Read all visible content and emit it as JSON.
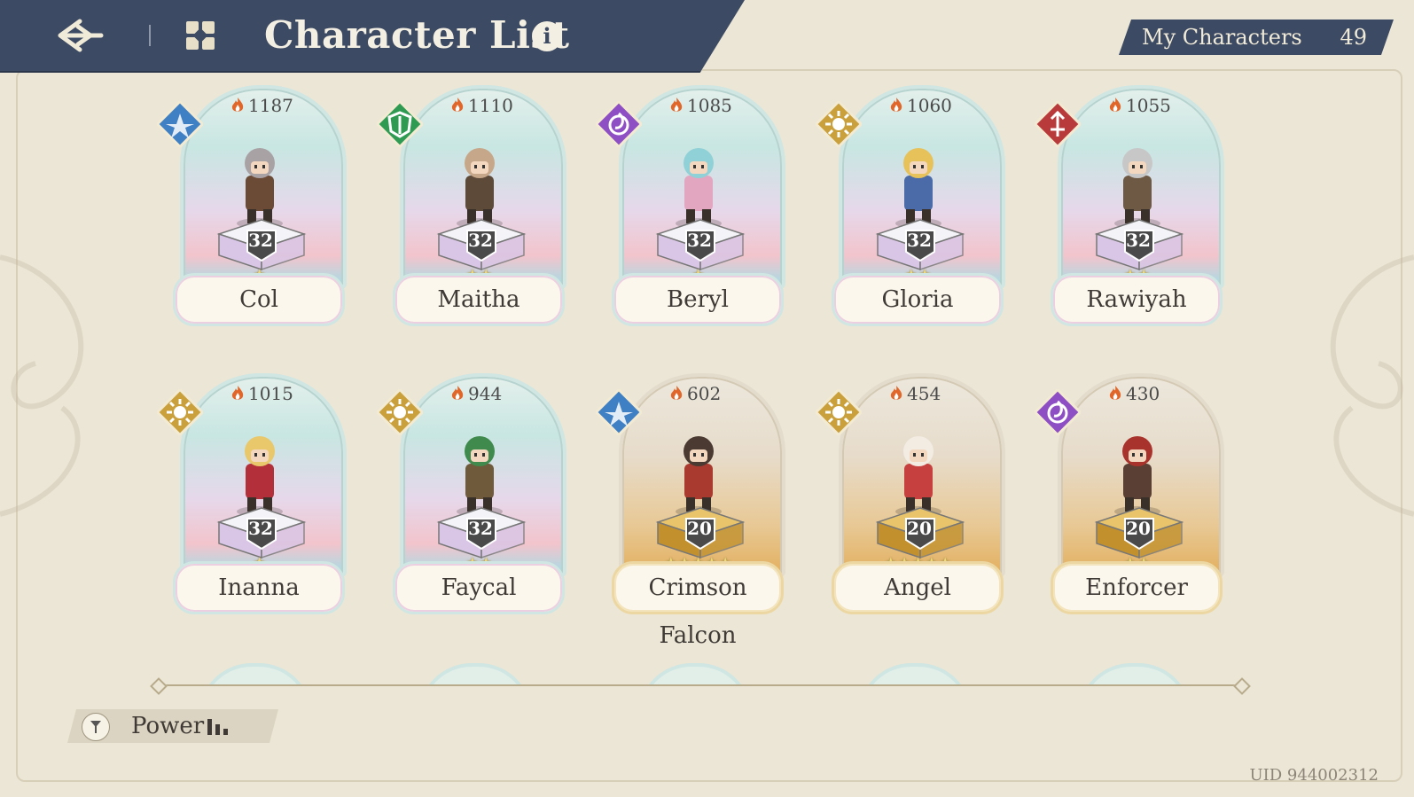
{
  "header": {
    "title": "Character List",
    "info_label": "i",
    "my_characters_label": "My Characters",
    "my_characters_count": "49"
  },
  "colors": {
    "header_bg": "#3d4a63",
    "page_bg": "#ece6d6",
    "element_storm": "#3f7fc4",
    "element_earth": "#2f9a52",
    "element_arcane": "#8e4fc4",
    "element_light": "#c9a03c",
    "element_fire": "#b83a3a"
  },
  "characters": [
    {
      "name": "Col",
      "power": "1187",
      "level": "32",
      "stars": "★",
      "element": "storm-icon",
      "rarity": "rainbow"
    },
    {
      "name": "Maitha",
      "power": "1110",
      "level": "32",
      "stars": "★★",
      "element": "earth-icon",
      "rarity": "rainbow"
    },
    {
      "name": "Beryl",
      "power": "1085",
      "level": "32",
      "stars": "★",
      "element": "arcane-icon",
      "rarity": "rainbow"
    },
    {
      "name": "Gloria",
      "power": "1060",
      "level": "32",
      "stars": "★★",
      "element": "light-icon",
      "rarity": "rainbow"
    },
    {
      "name": "Rawiyah",
      "power": "1055",
      "level": "32",
      "stars": "★★",
      "element": "fire-icon",
      "rarity": "rainbow"
    },
    {
      "name": "Inanna",
      "power": "1015",
      "level": "32",
      "stars": "★",
      "element": "light-icon",
      "rarity": "rainbow"
    },
    {
      "name": "Faycal",
      "power": "944",
      "level": "32",
      "stars": "★★",
      "element": "light-icon",
      "rarity": "rainbow"
    },
    {
      "name": "Crimson Falcon",
      "power": "602",
      "level": "20",
      "stars": "★★★★★",
      "element": "storm-icon",
      "rarity": "gold"
    },
    {
      "name": "Angel",
      "power": "454",
      "level": "20",
      "stars": "★★★★★",
      "element": "light-icon",
      "rarity": "gold"
    },
    {
      "name": "Enforcer",
      "power": "430",
      "level": "20",
      "stars": "★★",
      "element": "arcane-icon",
      "rarity": "gold"
    }
  ],
  "sort": {
    "label": "Power"
  },
  "footer": {
    "uid": "UID 944002312"
  }
}
